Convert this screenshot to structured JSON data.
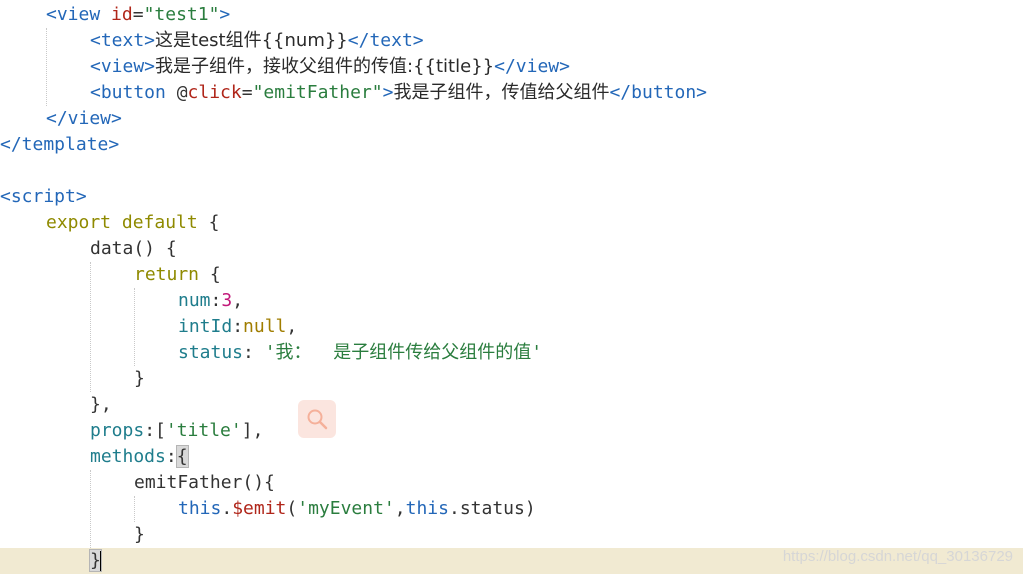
{
  "lines": [
    {
      "tokens": [
        {
          "t": "<view ",
          "c": "tag"
        },
        {
          "t": "id",
          "c": "attr"
        },
        {
          "t": "=",
          "c": "plain"
        },
        {
          "t": "\"test1\"",
          "c": "str"
        },
        {
          "t": ">",
          "c": "tag"
        }
      ]
    },
    {
      "tokens": [
        {
          "t": "<text>",
          "c": "tag"
        },
        {
          "t": "这是test组件{{num}}",
          "c": "txt"
        },
        {
          "t": "</text>",
          "c": "tag"
        }
      ]
    },
    {
      "tokens": [
        {
          "t": "<view>",
          "c": "tag"
        },
        {
          "t": "我是子组件，接收父组件的传值:{{title}}",
          "c": "txt"
        },
        {
          "t": "</view>",
          "c": "tag"
        }
      ]
    },
    {
      "tokens": [
        {
          "t": "<button ",
          "c": "tag"
        },
        {
          "t": "@",
          "c": "plain"
        },
        {
          "t": "click",
          "c": "attr"
        },
        {
          "t": "=",
          "c": "plain"
        },
        {
          "t": "\"emitFather\"",
          "c": "str"
        },
        {
          "t": ">",
          "c": "tag"
        },
        {
          "t": "我是子组件，传值给父组件",
          "c": "txt"
        },
        {
          "t": "</button>",
          "c": "tag"
        }
      ]
    },
    {
      "tokens": [
        {
          "t": "</view>",
          "c": "tag"
        }
      ]
    },
    {
      "tokens": [
        {
          "t": "</template>",
          "c": "tag"
        }
      ]
    },
    {
      "tokens": []
    },
    {
      "tokens": [
        {
          "t": "<script>",
          "c": "tag"
        }
      ]
    },
    {
      "tokens": [
        {
          "t": "export default ",
          "c": "kw"
        },
        {
          "t": "{",
          "c": "plain"
        }
      ]
    },
    {
      "tokens": [
        {
          "t": "data() {",
          "c": "plain"
        }
      ]
    },
    {
      "tokens": [
        {
          "t": "return ",
          "c": "kw"
        },
        {
          "t": "{",
          "c": "plain"
        }
      ]
    },
    {
      "tokens": [
        {
          "t": "num",
          "c": "prop"
        },
        {
          "t": ":",
          "c": "plain"
        },
        {
          "t": "3",
          "c": "num"
        },
        {
          "t": ",",
          "c": "plain"
        }
      ]
    },
    {
      "tokens": [
        {
          "t": "intId",
          "c": "prop"
        },
        {
          "t": ":",
          "c": "plain"
        },
        {
          "t": "null",
          "c": "nul"
        },
        {
          "t": ",",
          "c": "plain"
        }
      ]
    },
    {
      "tokens": [
        {
          "t": "status",
          "c": "prop"
        },
        {
          "t": ": ",
          "c": "plain"
        },
        {
          "t": "'我：  是子组件传给父组件的值'",
          "c": "str"
        }
      ]
    },
    {
      "tokens": [
        {
          "t": "}",
          "c": "plain"
        }
      ]
    },
    {
      "tokens": [
        {
          "t": "},",
          "c": "plain"
        }
      ]
    },
    {
      "tokens": [
        {
          "t": "props",
          "c": "prop"
        },
        {
          "t": ":[",
          "c": "plain"
        },
        {
          "t": "'title'",
          "c": "str"
        },
        {
          "t": "],",
          "c": "plain"
        }
      ]
    },
    {
      "tokens": [
        {
          "t": "methods",
          "c": "prop"
        },
        {
          "t": ":",
          "c": "plain"
        },
        {
          "t": "{",
          "c": "plain",
          "hl": true
        }
      ]
    },
    {
      "tokens": [
        {
          "t": "emitFather(){",
          "c": "plain"
        }
      ]
    },
    {
      "tokens": [
        {
          "t": "this",
          "c": "this"
        },
        {
          "t": ".",
          "c": "plain"
        },
        {
          "t": "$emit",
          "c": "attr"
        },
        {
          "t": "(",
          "c": "plain"
        },
        {
          "t": "'myEvent'",
          "c": "str"
        },
        {
          "t": ",",
          "c": "plain"
        },
        {
          "t": "this",
          "c": "this"
        },
        {
          "t": ".status)",
          "c": "plain"
        }
      ]
    },
    {
      "tokens": [
        {
          "t": "}",
          "c": "plain"
        }
      ]
    },
    {
      "tokens": [
        {
          "t": "}",
          "c": "plain",
          "hl": true,
          "cursor": true
        }
      ]
    }
  ],
  "watermark": "https://blog.csdn.net/qq_30136729",
  "icons": {
    "search": "search-icon"
  },
  "colors": {
    "current_line": "#f1ead2",
    "tag": "#2367b8",
    "string": "#2a7d3e",
    "keyword": "#8f8a00"
  }
}
